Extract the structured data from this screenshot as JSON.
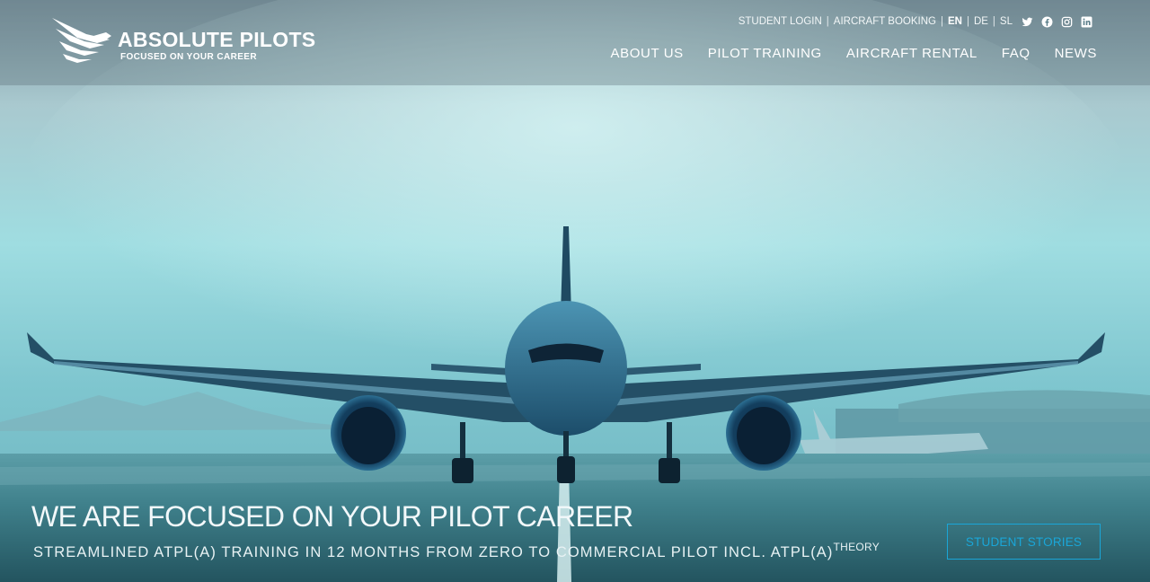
{
  "logo": {
    "brand": "ABSOLUTE PILOTS",
    "tagline": "FOCUSED ON YOUR CAREER",
    "icon": "eagle-wing-icon"
  },
  "topbar": {
    "student_login": "STUDENT LOGIN",
    "aircraft_booking": "AIRCRAFT BOOKING",
    "languages": [
      "EN",
      "DE",
      "SL"
    ],
    "active_language": "EN",
    "social_icons": [
      "twitter-icon",
      "facebook-icon",
      "instagram-icon",
      "linkedin-icon"
    ]
  },
  "nav": {
    "items": [
      "ABOUT US",
      "PILOT TRAINING",
      "AIRCRAFT RENTAL",
      "FAQ",
      "NEWS"
    ]
  },
  "hero": {
    "headline": "WE ARE FOCUSED ON YOUR PILOT CAREER",
    "subline": "STREAMLINED ATPL(A) TRAINING IN 12 MONTHS FROM ZERO TO COMMERCIAL PILOT INCL. ATPL(A)",
    "subline_sup": "THEORY",
    "cta": "STUDENT STORIES",
    "image": "airliner-on-runway"
  },
  "colors": {
    "accent": "#1aa6d8",
    "sky_top": "#8fa9b2",
    "sky_mid": "#8fd3da",
    "ground": "#3c7c86"
  }
}
